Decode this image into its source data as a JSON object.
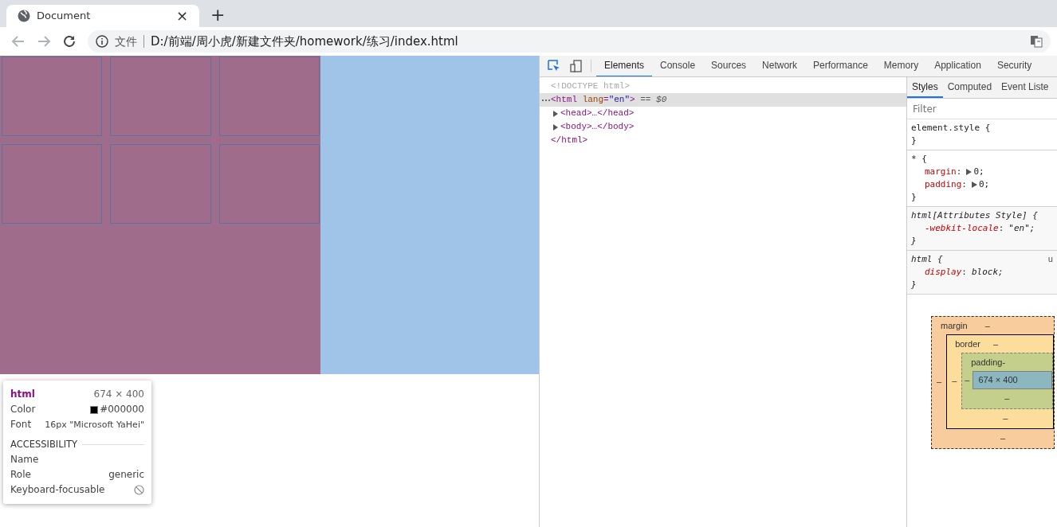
{
  "browser": {
    "tab": {
      "title": "Document",
      "close": "×"
    },
    "new_tab": "+",
    "address": {
      "security_label": "文件",
      "url": "D:/前端/周小虎/新建文件夹/homework/练习/index.html"
    }
  },
  "devtools": {
    "tabs": [
      {
        "label": "Elements",
        "selected": true
      },
      {
        "label": "Console",
        "selected": false
      },
      {
        "label": "Sources",
        "selected": false
      },
      {
        "label": "Network",
        "selected": false
      },
      {
        "label": "Performance",
        "selected": false
      },
      {
        "label": "Memory",
        "selected": false
      },
      {
        "label": "Application",
        "selected": false
      },
      {
        "label": "Security",
        "selected": false
      }
    ],
    "dom": [
      {
        "kind": "doctype",
        "text": "<!DOCTYPE html>"
      },
      {
        "kind": "element",
        "open": "<html",
        "attribute_name": "lang",
        "attribute_eq": "=",
        "attribute_value": "\"en\"",
        "open_end": ">",
        "marker": "== $0",
        "selected": true,
        "closing": "</html>",
        "children": [
          {
            "kind": "collapsed",
            "text": "<head>…</head>",
            "expanded": false
          },
          {
            "kind": "collapsed",
            "text": "<body>…</body>",
            "expanded": false
          }
        ]
      }
    ],
    "styles": {
      "tabs": [
        {
          "label": "Styles",
          "selected": true
        },
        {
          "label": "Computed",
          "selected": false
        },
        {
          "label": "Event Liste",
          "selected": false
        }
      ],
      "filter_placeholder": "Filter",
      "rules": [
        {
          "kind": "inline",
          "selector": "element.style {",
          "close": "}"
        },
        {
          "kind": "author",
          "selector": "* {",
          "declarations": [
            {
              "kind": "shorthand",
              "property": "margin",
              "colon": ":",
              "value": "0;"
            },
            {
              "kind": "shorthand",
              "property": "padding",
              "colon": ":",
              "value": "0;"
            }
          ],
          "close": "}"
        },
        {
          "kind": "user-agent",
          "selector": "html[Attributes Style] {",
          "declarations": [
            {
              "kind": "longhand",
              "property": "-webkit-locale",
              "colon": ":",
              "value": "\"en\";"
            }
          ],
          "close": "}"
        },
        {
          "kind": "user-agent",
          "selector": "html {",
          "source": "u",
          "declarations": [
            {
              "kind": "longhand",
              "property": "display",
              "colon": ":",
              "value": "block;"
            }
          ],
          "close": "}"
        }
      ],
      "box_model": {
        "margin": {
          "label": "margin",
          "top": "–",
          "left": "–",
          "bottom": "–"
        },
        "border": {
          "label": "border",
          "top": "–",
          "left": "–",
          "bottom": "–"
        },
        "padding": {
          "label": "padding",
          "top": "-",
          "left": "–",
          "bottom": "–"
        },
        "content": "674 × 400"
      }
    }
  },
  "tooltip": {
    "tag": "html",
    "size": "674 × 400",
    "color_label": "Color",
    "color_value": "#000000",
    "font_label": "Font",
    "font_value": "16px \"Microsoft YaHei\"",
    "section": "ACCESSIBILITY",
    "name_label": "Name",
    "role_label": "Role",
    "role_value": "generic",
    "focusable_label": "Keyboard-focusable"
  }
}
